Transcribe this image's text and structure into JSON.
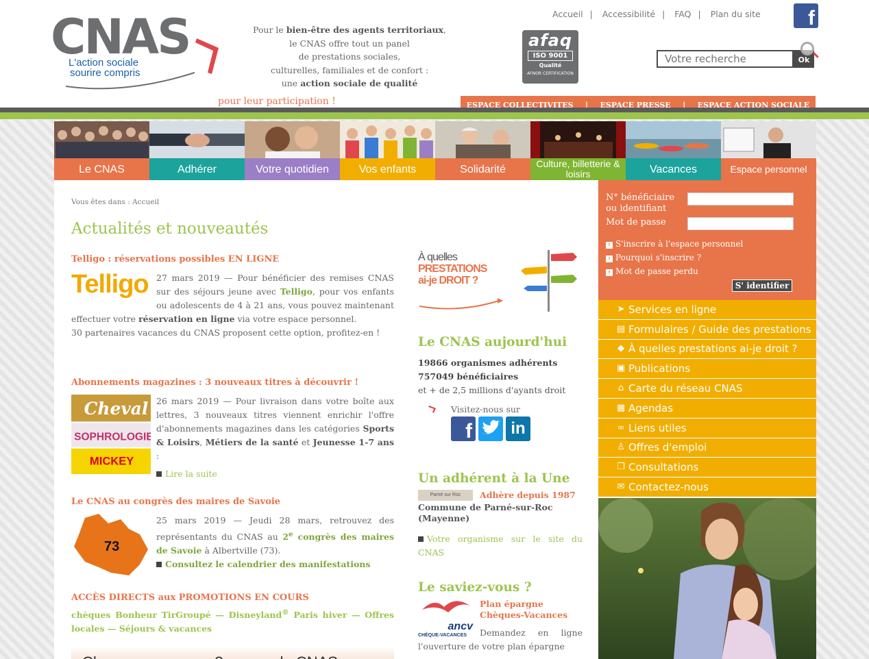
{
  "header": {
    "logo_text": "CNAS",
    "logo_tagline_1": "L'action sociale",
    "logo_tagline_2": "sourire compris",
    "intro_lines": [
      [
        "Pour le ",
        "bien-être des agents territoriaux",
        ","
      ],
      [
        "le CNAS offre tout un panel",
        "",
        ""
      ],
      [
        "de prestations sociales,",
        "",
        ""
      ],
      [
        "culturelles, familiales et de confort :",
        "",
        ""
      ],
      [
        "une ",
        "action sociale de qualité",
        ""
      ]
    ],
    "intro_cta": "pour leur participation !",
    "afaq": {
      "brand": "afaq",
      "iso": "ISO 9001",
      "quality": "Qualité",
      "cert": "AFNOR CERTIFICATION"
    },
    "top_links": [
      "Accueil",
      "Accessibilité",
      "FAQ",
      "Plan du site"
    ],
    "search_placeholder": "Votre recherche",
    "search_button": "Ok",
    "espaces": [
      "ESPACE COLLECTIVITES",
      "ESPACE PRESSE",
      "ESPACE ACTION SOCIALE"
    ],
    "colors": {
      "orange": "#e8744a",
      "green": "#9dc44d",
      "yellow": "#f2ae00",
      "teal": "#1ba39c",
      "purple": "#9b7fc6"
    }
  },
  "nav": [
    {
      "label": "Le CNAS",
      "color": "#e8744a"
    },
    {
      "label": "Adhérer",
      "color": "#1ba39c"
    },
    {
      "label": "Votre quotidien",
      "color": "#9b7fc6"
    },
    {
      "label": "Vos enfants",
      "color": "#f2ae00"
    },
    {
      "label": "Solidarité",
      "color": "#e8744a"
    },
    {
      "label": "Culture, billetterie & loisirs",
      "color": "#7fb532"
    },
    {
      "label": "Vacances",
      "color": "#1ba39c"
    },
    {
      "label": "Espace personnel",
      "color": "#e8744a"
    }
  ],
  "main": {
    "breadcrumb": "Vous êtes dans : Accueil",
    "heading": "Actualités et nouveautés",
    "news": [
      {
        "title": "Telligo : réservations possibles EN LIGNE",
        "logo": "Telligo",
        "date_intro": "27 mars 2019 — Pour bénéficier des remises CNAS sur des séjours jeune avec ",
        "strong1": "Telligo",
        "mid": ", pour vos enfants ou adolescents de 4 à 21 ans, vous pouvez maintenant effectuer votre ",
        "strong2": "réservation en ligne",
        "end": " via votre espace personnel.",
        "line2": "30 partenaires vacances du CNAS proposent cette option, profitez-en !"
      },
      {
        "title": "Abonnements magazines : 3 nouveaux titres à découvrir !",
        "mag_labels": [
          "Cheval",
          "SOPHROLOGIE",
          "MICKEY"
        ],
        "text1": "26 mars 2019 — Pour livraison dans votre boîte aux lettres, 3 nouveaux titres viennent enrichir l'offre d'abonnements magazines dans les catégories ",
        "cat1": "Sports & Loisirs",
        "sep1": ", ",
        "cat2": "Métiers de la santé",
        "sep2": " et ",
        "cat3": "Jeunesse 1-7 ans",
        "text_end": " :",
        "more": "Lire la suite"
      },
      {
        "title": "Le CNAS au congrès des maires de Savoie",
        "map_label": "73",
        "text1": "25 mars 2019 — Jeudi 28 mars, retrouvez des représentants du CNAS au ",
        "link1": "2",
        "link1_sup": "e",
        "link1_end": " congrès des maires de Savoie",
        "text2": " à Albertville (73).",
        "more": "Consultez le calendrier des manifestations"
      }
    ],
    "promos_title": "ACCÈS DIRECTS aux PROMOTIONS EN COURS",
    "promos": [
      "chèques Bonheur TirGroupé",
      "Disneyland",
      "Paris hiver",
      "Offres locales",
      "Séjours & vacances"
    ],
    "promo_sep": " — ",
    "reg": "®",
    "banner_text": "Cheques vacances ? ... avec le CNAS",
    "right": {
      "prestations_title_1": "À quelles",
      "prestations_title_2": "PRESTATIONS",
      "prestations_title_3": "ai-je DROIT ?",
      "today_title": "Le CNAS aujourd'hui",
      "stat1": "19866 organismes adhérents",
      "stat2": "757049 bénéficiaires",
      "stat3": "et + de 2,5 millions d'ayants droit",
      "visit": "Visitez-nous sur",
      "une_title": "Un adhérent à la Une",
      "une_since": "Adhère depuis 1987",
      "une_name": "Commune de Parné-sur-Roc (Mayenne)",
      "une_more": "Votre organisme sur le site du CNAS",
      "sign_text": "Parné sur Roc",
      "savez_title": "Le saviez-vous ?",
      "savez_link": "Plan épargne Chèques-Vacances",
      "ancv_text": "ancv",
      "ancv_sub": "CHÈQUE-VACANCES",
      "savez_text": "Demandez en ligne l'ouverture de votre plan épargne"
    }
  },
  "side": {
    "login_label1": "N° bénéficiaire ou identifiant",
    "login_label2": "Mot de passe",
    "links": [
      "S'inscrire à l'espace personnel",
      "Pourquoi s'inscrire ?",
      "Mot de passe perdu"
    ],
    "login_button": "S' identifier",
    "menu": [
      {
        "label": "Services en ligne",
        "icon": "cursor-icon",
        "glyph": "➤"
      },
      {
        "label": "Formulaires / Guide des prestations",
        "icon": "document-icon",
        "glyph": "▤"
      },
      {
        "label": "À quelles prestations ai-je droit ?",
        "icon": "question-icon",
        "glyph": "◆"
      },
      {
        "label": "Publications",
        "icon": "publications-icon",
        "glyph": "▣"
      },
      {
        "label": "Carte du réseau CNAS",
        "icon": "map-icon",
        "glyph": "⌂"
      },
      {
        "label": "Agendas",
        "icon": "calendar-icon",
        "glyph": "▦"
      },
      {
        "label": "Liens utiles",
        "icon": "link-icon",
        "glyph": "∞"
      },
      {
        "label": "Offres d'emploi",
        "icon": "person-icon",
        "glyph": "♙"
      },
      {
        "label": "Consultations",
        "icon": "consultations-icon",
        "glyph": "❐"
      },
      {
        "label": "Contactez-nous",
        "icon": "mail-icon",
        "glyph": "✉"
      }
    ]
  }
}
